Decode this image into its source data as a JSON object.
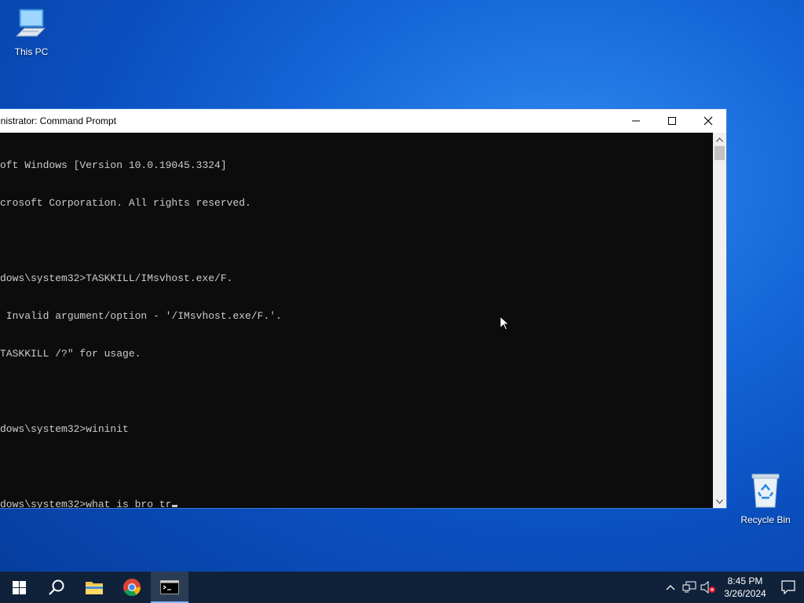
{
  "desktop": {
    "icons": [
      {
        "label": "This PC"
      },
      {
        "label": "Recycle Bin"
      }
    ]
  },
  "window": {
    "title": "inistrator: Command Prompt",
    "console_lines": [
      "oft Windows [Version 10.0.19045.3324]",
      "crosoft Corporation. All rights reserved.",
      "",
      "dows\\system32>TASKKILL/IMsvhost.exe/F.",
      " Invalid argument/option - '/IMsvhost.exe/F.'.",
      "TASKKILL /?\" for usage.",
      "",
      "dows\\system32>wininit",
      "",
      "dows\\system32>what is bro tr"
    ]
  },
  "taskbar": {
    "apps": [
      "start",
      "search",
      "file-explorer",
      "chrome",
      "command-prompt"
    ],
    "clock": {
      "time": "8:45 PM",
      "date": "3/26/2024"
    }
  },
  "colors": {
    "console_bg": "#0c0c0c",
    "console_fg": "#cccccc",
    "taskbar_bg": "#10223a"
  }
}
